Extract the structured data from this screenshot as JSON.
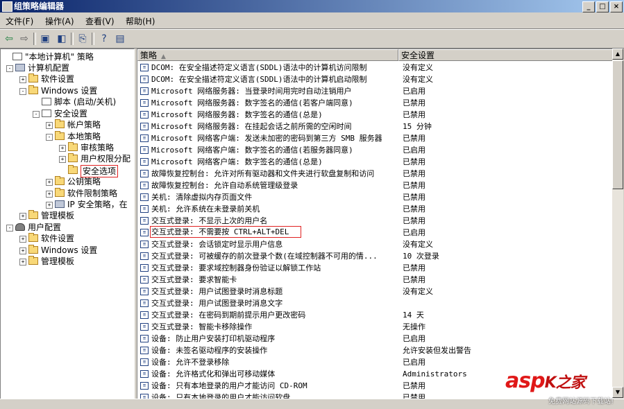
{
  "window": {
    "title": "组策略编辑器",
    "controls": [
      "_",
      "□",
      "×"
    ]
  },
  "menu": [
    "文件(F)",
    "操作(A)",
    "查看(V)",
    "帮助(H)"
  ],
  "toolbar": [
    "back-icon",
    "forward-icon",
    "up-folder-icon",
    "show-hide-tree-icon",
    "export-list-icon",
    "help-icon",
    "properties-icon"
  ],
  "tree": [
    {
      "label": "\"本地计算机\" 策略",
      "icon": "doc",
      "expander": ""
    },
    {
      "label": "计算机配置",
      "icon": "comp",
      "expander": "-"
    },
    {
      "label": "软件设置",
      "icon": "folder",
      "expander": "+"
    },
    {
      "label": "Windows 设置",
      "icon": "folder",
      "expander": "-"
    },
    {
      "label": "脚本 (启动/关机)",
      "icon": "doc",
      "expander": ""
    },
    {
      "label": "安全设置",
      "icon": "doc",
      "expander": "-"
    },
    {
      "label": "帐户策略",
      "icon": "folder",
      "expander": "+"
    },
    {
      "label": "本地策略",
      "icon": "folder",
      "expander": "-"
    },
    {
      "label": "审核策略",
      "icon": "folder",
      "expander": "+"
    },
    {
      "label": "用户权限分配",
      "icon": "folder",
      "expander": "+"
    },
    {
      "label": "安全选项",
      "icon": "folder",
      "expander": ""
    },
    {
      "label": "公钥策略",
      "icon": "folder",
      "expander": "+"
    },
    {
      "label": "软件限制策略",
      "icon": "folder",
      "expander": "+"
    },
    {
      "label": "IP 安全策略，在",
      "icon": "comp",
      "expander": "+"
    },
    {
      "label": "管理模板",
      "icon": "folder",
      "expander": "+"
    },
    {
      "label": "用户配置",
      "icon": "user",
      "expander": "-"
    },
    {
      "label": "软件设置",
      "icon": "folder",
      "expander": "+"
    },
    {
      "label": "Windows 设置",
      "icon": "folder",
      "expander": "+"
    },
    {
      "label": "管理模板",
      "icon": "folder",
      "expander": "+"
    }
  ],
  "columns": {
    "policy": "策略",
    "setting": "安全设置"
  },
  "rows": [
    {
      "name": "DCOM: 在安全描述符定义语言(SDDL)语法中的计算机访问限制",
      "setting": "没有定义"
    },
    {
      "name": "DCOM: 在安全描述符定义语言(SDDL)语法中的计算机启动限制",
      "setting": "没有定义"
    },
    {
      "name": "Microsoft 网络服务器: 当登录时间用完时自动注销用户",
      "setting": "已启用"
    },
    {
      "name": "Microsoft 网络服务器: 数字签名的通信(若客户端同意)",
      "setting": "已禁用"
    },
    {
      "name": "Microsoft 网络服务器: 数字签名的通信(总是)",
      "setting": "已禁用"
    },
    {
      "name": "Microsoft 网络服务器: 在挂起会话之前所需的空闲时间",
      "setting": "15 分钟"
    },
    {
      "name": "Microsoft 网络客户端: 发送未加密的密码到第三方 SMB 服务器",
      "setting": "已禁用"
    },
    {
      "name": "Microsoft 网络客户端: 数字签名的通信(若服务器同意)",
      "setting": "已启用"
    },
    {
      "name": "Microsoft 网络客户端: 数字签名的通信(总是)",
      "setting": "已禁用"
    },
    {
      "name": "故障恢复控制台: 允许对所有驱动器和文件夹进行软盘复制和访问",
      "setting": "已禁用"
    },
    {
      "name": "故障恢复控制台: 允许自动系统管理级登录",
      "setting": "已禁用"
    },
    {
      "name": "关机: 清除虚拟内存页面文件",
      "setting": "已禁用"
    },
    {
      "name": "关机: 允许系统在未登录前关机",
      "setting": "已禁用"
    },
    {
      "name": "交互式登录: 不显示上次的用户名",
      "setting": "已禁用"
    },
    {
      "name": "交互式登录: 不需要按 CTRL+ALT+DEL",
      "setting": "已启用",
      "highlight": true
    },
    {
      "name": "交互式登录: 会话锁定时显示用户信息",
      "setting": "没有定义"
    },
    {
      "name": "交互式登录: 可被缓存的前次登录个数(在域控制器不可用的情...",
      "setting": "10 次登录"
    },
    {
      "name": "交互式登录: 要求域控制器身份验证以解锁工作站",
      "setting": "已禁用"
    },
    {
      "name": "交互式登录: 要求智能卡",
      "setting": "已禁用"
    },
    {
      "name": "交互式登录: 用户试图登录时消息标题",
      "setting": "没有定义"
    },
    {
      "name": "交互式登录: 用户试图登录时消息文字",
      "setting": ""
    },
    {
      "name": "交互式登录: 在密码到期前提示用户更改密码",
      "setting": "14 天"
    },
    {
      "name": "交互式登录: 智能卡移除操作",
      "setting": "无操作"
    },
    {
      "name": "设备: 防止用户安装打印机驱动程序",
      "setting": "已启用"
    },
    {
      "name": "设备: 未签名驱动程序的安装操作",
      "setting": "允许安装但发出警告"
    },
    {
      "name": "设备: 允许不登录移除",
      "setting": "已启用"
    },
    {
      "name": "设备: 允许格式化和弹出可移动媒体",
      "setting": "Administrators"
    },
    {
      "name": "设备: 只有本地登录的用户才能访问 CD-ROM",
      "setting": "已禁用"
    },
    {
      "name": "设备: 只有本地登录的用户才能访问软盘",
      "setting": "已禁用"
    }
  ],
  "watermark": {
    "logo": "asp",
    "suffix": "K之家",
    "sub": "免费网站源码下载站!"
  }
}
